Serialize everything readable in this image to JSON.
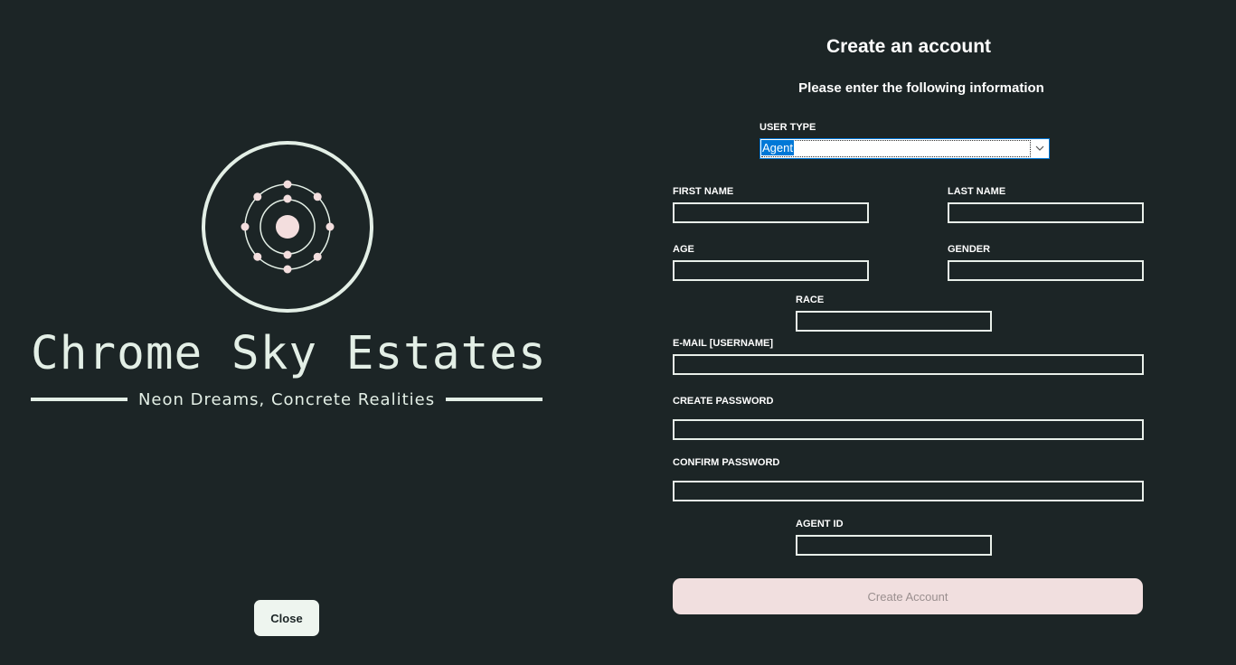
{
  "brand": {
    "name": "Chrome Sky Estates",
    "tagline": "Neon Dreams, Concrete Realities"
  },
  "left": {
    "close_label": "Close"
  },
  "form": {
    "title": "Create an account",
    "subtitle": "Please enter the following information",
    "user_type": {
      "label": "USER TYPE",
      "selected": "Agent"
    },
    "first_name": {
      "label": "FIRST NAME",
      "value": ""
    },
    "last_name": {
      "label": "LAST NAME",
      "value": ""
    },
    "age": {
      "label": "AGE",
      "value": ""
    },
    "gender": {
      "label": "GENDER",
      "value": ""
    },
    "race": {
      "label": "RACE",
      "value": ""
    },
    "email": {
      "label": "E-MAIL [USERNAME]",
      "value": ""
    },
    "create_password": {
      "label": "CREATE PASSWORD",
      "value": ""
    },
    "confirm_password": {
      "label": "CONFIRM PASSWORD",
      "value": ""
    },
    "agent_id": {
      "label": "AGENT ID",
      "value": ""
    },
    "submit_label": "Create Account"
  },
  "colors": {
    "background": "#1c2526",
    "logo": "#e3efe6",
    "logo_dots": "#f3dede",
    "input_border": "#e8efe9",
    "create_button_bg": "#f1dfdf",
    "select_highlight": "#0078d7"
  },
  "icons": {
    "logo": "atom-icon",
    "select_arrow": "chevron-down-icon"
  }
}
